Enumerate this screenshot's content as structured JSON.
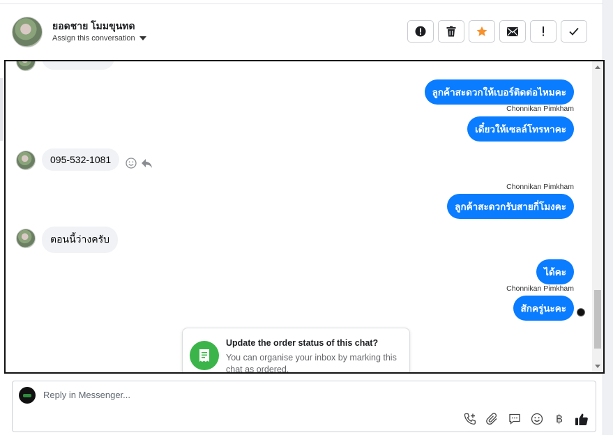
{
  "header": {
    "contact_name": "ยอดชาย โมมขุนทด",
    "assign_label": "Assign this conversation",
    "actions": [
      "spam-icon",
      "delete-icon",
      "star-icon",
      "mark-unread-icon",
      "follow-up-icon",
      "done-icon"
    ],
    "star_color": "#f5922f"
  },
  "chat": {
    "partial_top_text": "...",
    "messages": [
      {
        "dir": "out",
        "text": "ลูกค้าสะดวกให้เบอร์ติดต่อไหมคะ"
      },
      {
        "dir": "sender",
        "text": "Chonnikan Pimkham"
      },
      {
        "dir": "out",
        "text": "เดี๋ยวให้เซลล์โทรหาคะ"
      },
      {
        "dir": "in",
        "text": "095-532-1081"
      },
      {
        "dir": "sender",
        "text": "Chonnikan Pimkham"
      },
      {
        "dir": "out",
        "text": "ลูกค้าสะดวกรับสายกี่โมงคะ"
      },
      {
        "dir": "in",
        "text": "ตอนนี้ว่างครับ"
      },
      {
        "dir": "out",
        "text": "ได้คะ"
      },
      {
        "dir": "sender",
        "text": "Chonnikan Pimkham"
      },
      {
        "dir": "out",
        "text": "สักครู่นะคะ"
      }
    ],
    "bubble_color": "#0a7cff"
  },
  "order_card": {
    "title": "Update the order status of this chat?",
    "body": "You can organise your inbox by marking this chat as ordered.",
    "icon": "receipt-icon",
    "icon_color": "#3bb54a"
  },
  "composer": {
    "placeholder": "Reply in Messenger...",
    "tools": [
      "call-add-icon",
      "attachment-icon",
      "saved-reply-icon",
      "emoji-icon",
      "baht-icon",
      "like-icon"
    ],
    "baht_glyph": "฿"
  }
}
